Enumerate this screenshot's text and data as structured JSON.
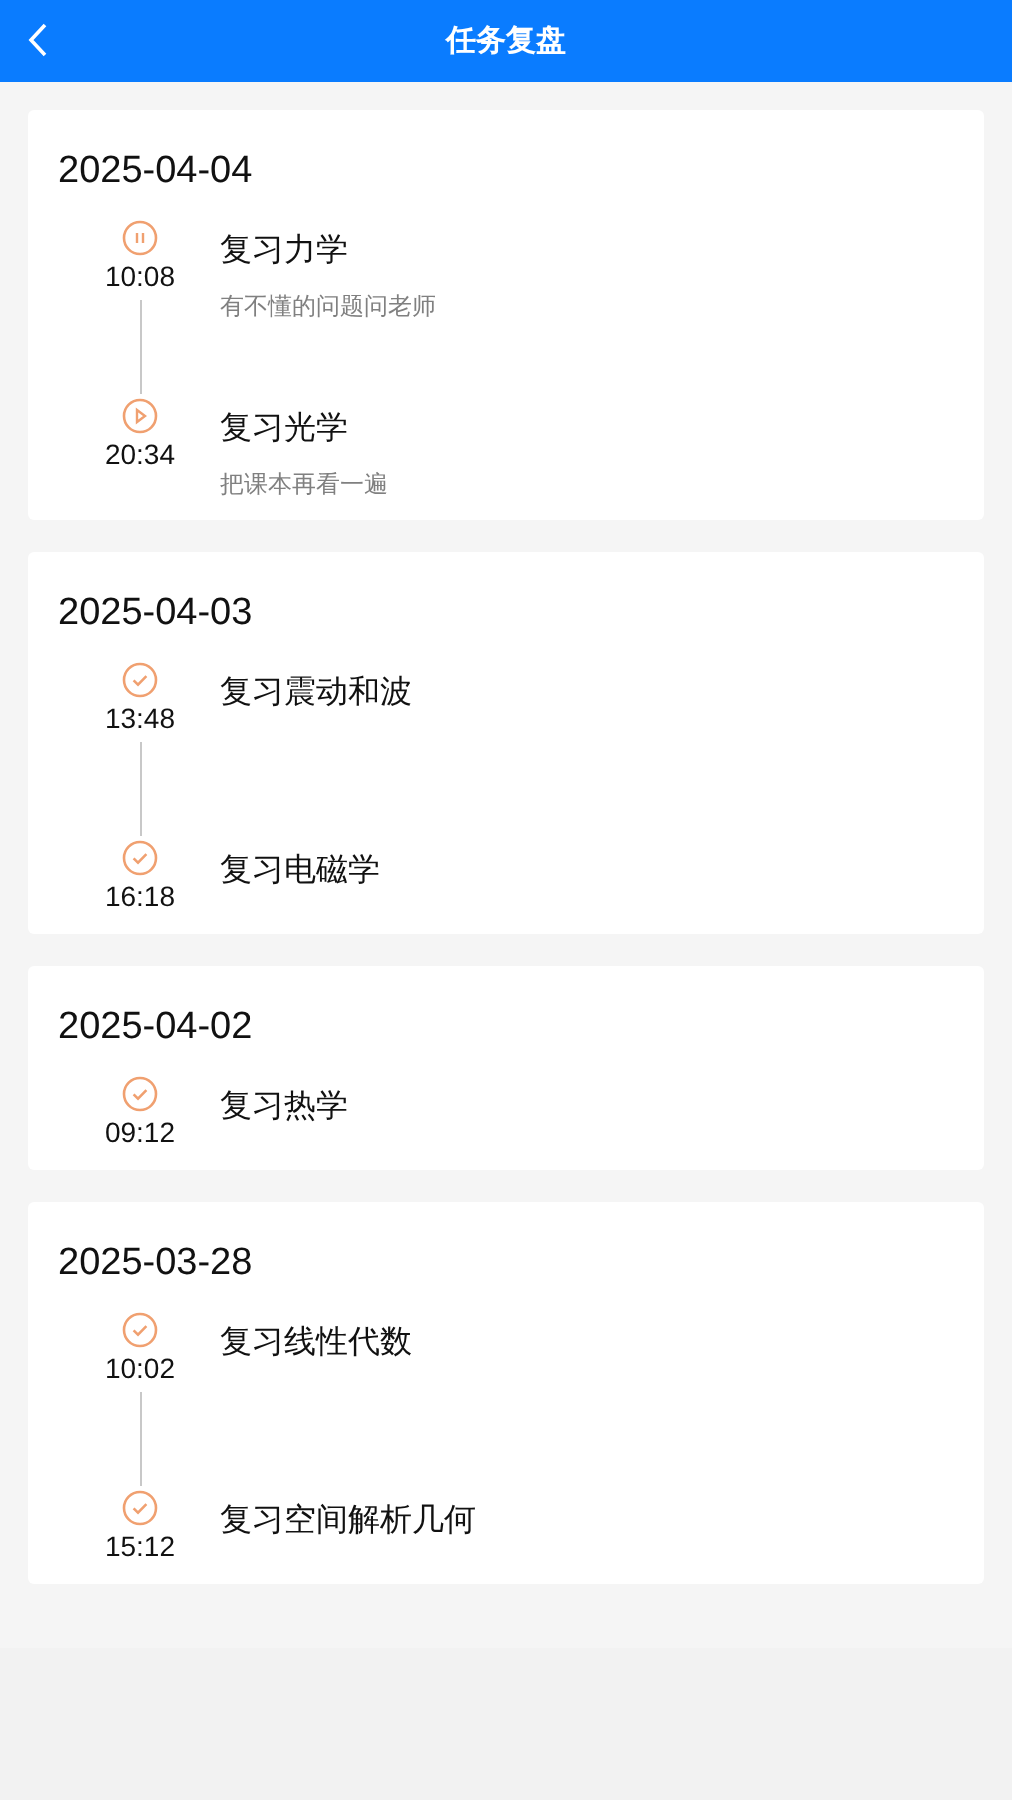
{
  "header": {
    "title": "任务复盘"
  },
  "days": [
    {
      "date": "2025-04-04",
      "tasks": [
        {
          "kind": "paused",
          "time": "10:08",
          "title": "复习力学",
          "note": "有不懂的问题问老师"
        },
        {
          "kind": "playing",
          "time": "20:34",
          "title": "复习光学",
          "note": "把课本再看一遍"
        }
      ]
    },
    {
      "date": "2025-04-03",
      "tasks": [
        {
          "kind": "done",
          "time": "13:48",
          "title": "复习震动和波"
        },
        {
          "kind": "done",
          "time": "16:18",
          "title": "复习电磁学"
        }
      ]
    },
    {
      "date": "2025-04-02",
      "tasks": [
        {
          "kind": "done",
          "time": "09:12",
          "title": "复习热学"
        }
      ]
    },
    {
      "date": "2025-03-28",
      "tasks": [
        {
          "kind": "done",
          "time": "10:02",
          "title": "复习线性代数"
        },
        {
          "kind": "done",
          "time": "15:12",
          "title": "复习空间解析几何"
        }
      ]
    }
  ]
}
